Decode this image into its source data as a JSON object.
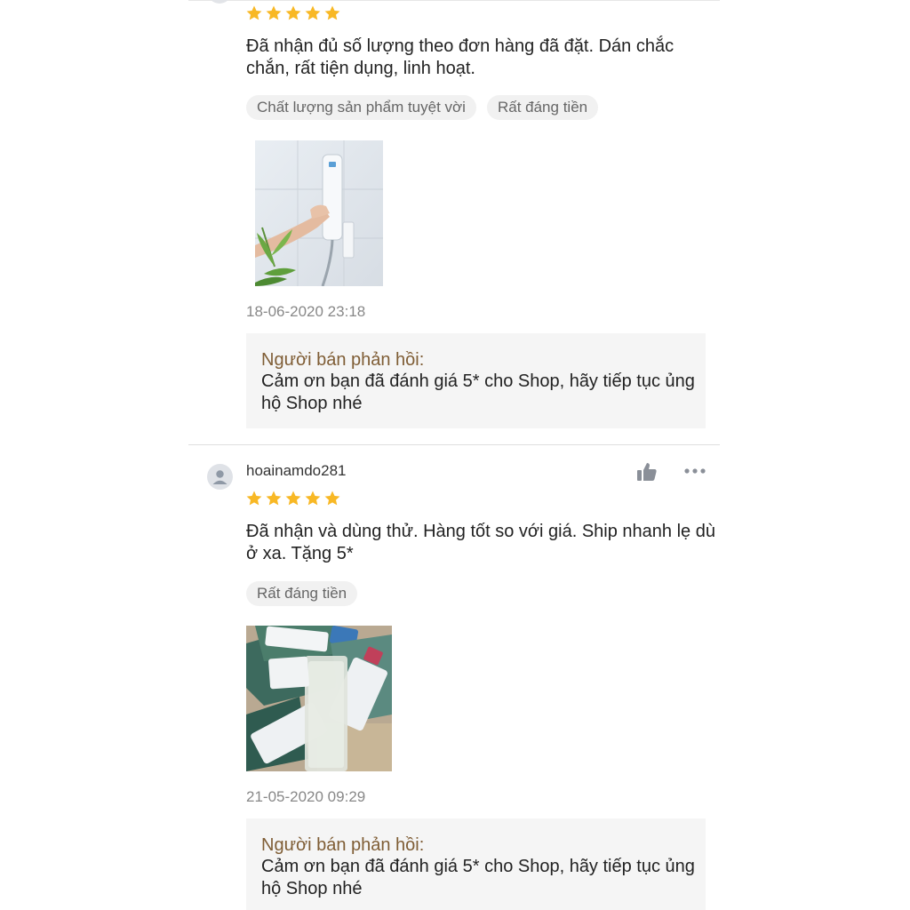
{
  "reviews": [
    {
      "rating": 5,
      "comment": "Đã nhận đủ số lượng theo đơn hàng đã đặt. Dán chắc chắn, rất tiện dụng, linh hoạt.",
      "tags": [
        "Chất lượng sản phẩm tuyệt vời",
        "Rất đáng tiền"
      ],
      "date": "18-06-2020 23:18",
      "reply_title": "Người bán phản hồi:",
      "reply_body": "Cảm ơn bạn đã đánh giá 5* cho Shop, hãy tiếp tục ủng hộ Shop nhé"
    },
    {
      "username": "hoainamdo281",
      "rating": 5,
      "comment": "Đã nhận và dùng thử. Hàng tốt so với giá. Ship nhanh lẹ dù ở xa. Tặng 5*",
      "tags": [
        "Rất đáng tiền"
      ],
      "date": "21-05-2020 09:29",
      "reply_title": "Người bán phản hồi:",
      "reply_body": "Cảm ơn bạn đã đánh giá 5* cho Shop, hãy tiếp tục ủng hộ Shop nhé"
    }
  ],
  "colors": {
    "star": "#f8b825",
    "reply_title": "#7f5d35",
    "chip_bg": "#f1f1f1"
  },
  "icons": [
    "star-icon",
    "user-avatar-icon",
    "thumbs-up-icon",
    "more-icon"
  ]
}
